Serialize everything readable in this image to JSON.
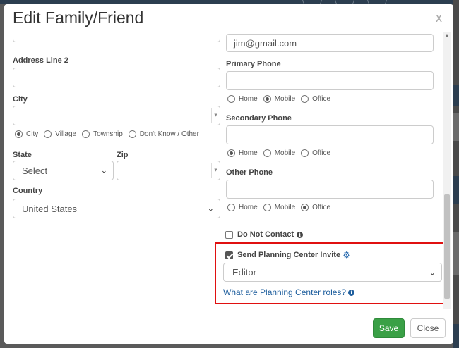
{
  "modal": {
    "title": "Edit Family/Friend",
    "close_glyph": "x"
  },
  "left": {
    "address_line_2_label": "Address Line 2",
    "address_line_2_value": "",
    "city_label": "City",
    "city_value": "",
    "city_type_options": [
      {
        "label": "City",
        "checked": true
      },
      {
        "label": "Village",
        "checked": false
      },
      {
        "label": "Township",
        "checked": false
      },
      {
        "label": "Don't Know / Other",
        "checked": false
      }
    ],
    "state_label": "State",
    "state_value": "Select",
    "zip_label": "Zip",
    "zip_value": "",
    "country_label": "Country",
    "country_value": "United States"
  },
  "right": {
    "email_value": "jim@gmail.com",
    "primary_phone_label": "Primary Phone",
    "primary_phone_value": "",
    "primary_phone_types": [
      {
        "label": "Home",
        "checked": false
      },
      {
        "label": "Mobile",
        "checked": true
      },
      {
        "label": "Office",
        "checked": false
      }
    ],
    "secondary_phone_label": "Secondary Phone",
    "secondary_phone_value": "",
    "secondary_phone_types": [
      {
        "label": "Home",
        "checked": true
      },
      {
        "label": "Mobile",
        "checked": false
      },
      {
        "label": "Office",
        "checked": false
      }
    ],
    "other_phone_label": "Other Phone",
    "other_phone_value": "",
    "other_phone_types": [
      {
        "label": "Home",
        "checked": false
      },
      {
        "label": "Mobile",
        "checked": false
      },
      {
        "label": "Office",
        "checked": true
      }
    ],
    "do_not_contact_label": "Do Not Contact",
    "do_not_contact_checked": false,
    "send_invite_label": "Send Planning Center Invite",
    "send_invite_checked": true,
    "role_value": "Editor",
    "roles_link": "What are Planning Center roles?"
  },
  "footer": {
    "save_label": "Save",
    "close_label": "Close"
  },
  "colors": {
    "save_button": "#3aa046",
    "link": "#1f5f9e",
    "highlight_border": "#e01010"
  },
  "icons": {
    "info": "info-icon",
    "gear": "gear-icon",
    "chevron": "chevron-down-icon"
  }
}
